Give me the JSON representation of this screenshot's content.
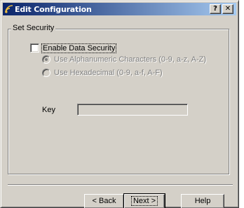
{
  "window": {
    "title": "Edit Configuration",
    "help_button": "?",
    "close_button": "✕"
  },
  "group": {
    "label": "Set Security"
  },
  "security": {
    "enable_label": "Enable Data Security",
    "enable_checked": false,
    "alphanumeric_label": "Use Alphanumeric Characters (0-9, a-z, A-Z)",
    "hex_label": "Use Hexadecimal (0-9, a-f, A-F)",
    "selected_option": "alphanumeric",
    "key_label": "Key",
    "key_value": ""
  },
  "buttons": {
    "back": "< Back",
    "next": "Next >",
    "help": "Help"
  },
  "colors": {
    "face": "#d4d0c8",
    "title_start": "#0a246a",
    "title_end": "#a6caf0",
    "disabled_text": "#808080"
  }
}
